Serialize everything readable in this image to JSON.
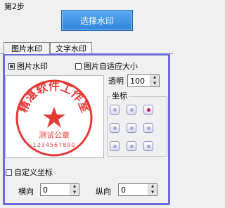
{
  "step_label": "第2步",
  "choose_button": "选择水印",
  "tabs": [
    {
      "label": "图片水印",
      "active": true
    },
    {
      "label": "文字水印",
      "active": false
    }
  ],
  "panel": {
    "image_watermark": {
      "label": "图片水印",
      "checked": true
    },
    "auto_fit": {
      "label": "图片自适应大小",
      "checked": false
    },
    "opacity": {
      "label": "透明",
      "value": "100"
    },
    "coordinate_group": {
      "title": "坐标",
      "selected": "top-right"
    },
    "custom_coordinate": {
      "label": "自定义坐标",
      "checked": false
    },
    "horizontal": {
      "label": "横向",
      "value": "0"
    },
    "vertical": {
      "label": "纵向",
      "value": "0"
    }
  },
  "stamp": {
    "arc_text": "精湛软件工作室",
    "line1": "测试公章",
    "line2": "1234567890",
    "color": "#e53935"
  },
  "colors": {
    "panel_border": "#6b6bdb",
    "button": "#3b8fe3"
  }
}
